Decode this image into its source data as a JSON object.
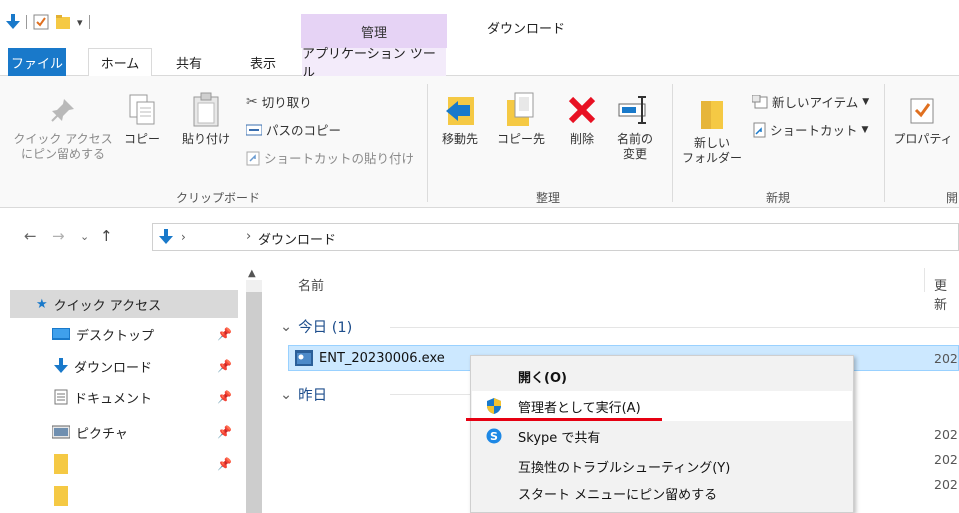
{
  "window": {
    "title": "ダウンロード",
    "contextual_header": "管理"
  },
  "ribbon_tabs": [
    "ファイル",
    "ホーム",
    "共有",
    "表示",
    "アプリケーション ツール"
  ],
  "ribbon": {
    "pin_quick_access": "クイック アクセス\nにピン留めする",
    "copy": "コピー",
    "paste": "貼り付け",
    "cut": "切り取り",
    "copy_path": "パスのコピー",
    "paste_shortcut": "ショートカットの貼り付け",
    "group_clipboard": "クリップボード",
    "move_to": "移動先",
    "copy_to": "コピー先",
    "delete": "削除",
    "rename": "名前の\n変更",
    "group_organize": "整理",
    "new_folder": "新しい\nフォルダー",
    "new_item": "新しいアイテム",
    "easy_access": "ショートカット",
    "group_new": "新規",
    "properties": "プロパティ",
    "group_open_partial": "開"
  },
  "address": {
    "crumb": "ダウンロード",
    "sep1": "›",
    "sep2": "›"
  },
  "navpane": {
    "quick_access": "クイック アクセス",
    "items": [
      {
        "label": "デスクトップ"
      },
      {
        "label": "ダウンロード"
      },
      {
        "label": "ドキュメント"
      },
      {
        "label": "ピクチャ"
      },
      {
        "label": ""
      },
      {
        "label": ""
      }
    ]
  },
  "filelist": {
    "col_name": "名前",
    "col_modified_partial": "更新",
    "group_today": "今日 (1)",
    "group_yesterday": "昨日",
    "file_name": "ENT_20230006.exe",
    "dates": [
      "202",
      "202",
      "202",
      "202"
    ]
  },
  "context_menu": {
    "items": [
      {
        "label": "開く(O)"
      },
      {
        "label": "管理者として実行(A)"
      },
      {
        "label": "Skype で共有"
      },
      {
        "label": "互換性のトラブルシューティング(Y)"
      },
      {
        "label": "スタート メニューにピン留めする"
      }
    ]
  },
  "colors": {
    "accent": "#1979ca",
    "selection": "#cce8ff",
    "highlight_underline": "#e60012",
    "contextual": "#e6d3f5"
  }
}
